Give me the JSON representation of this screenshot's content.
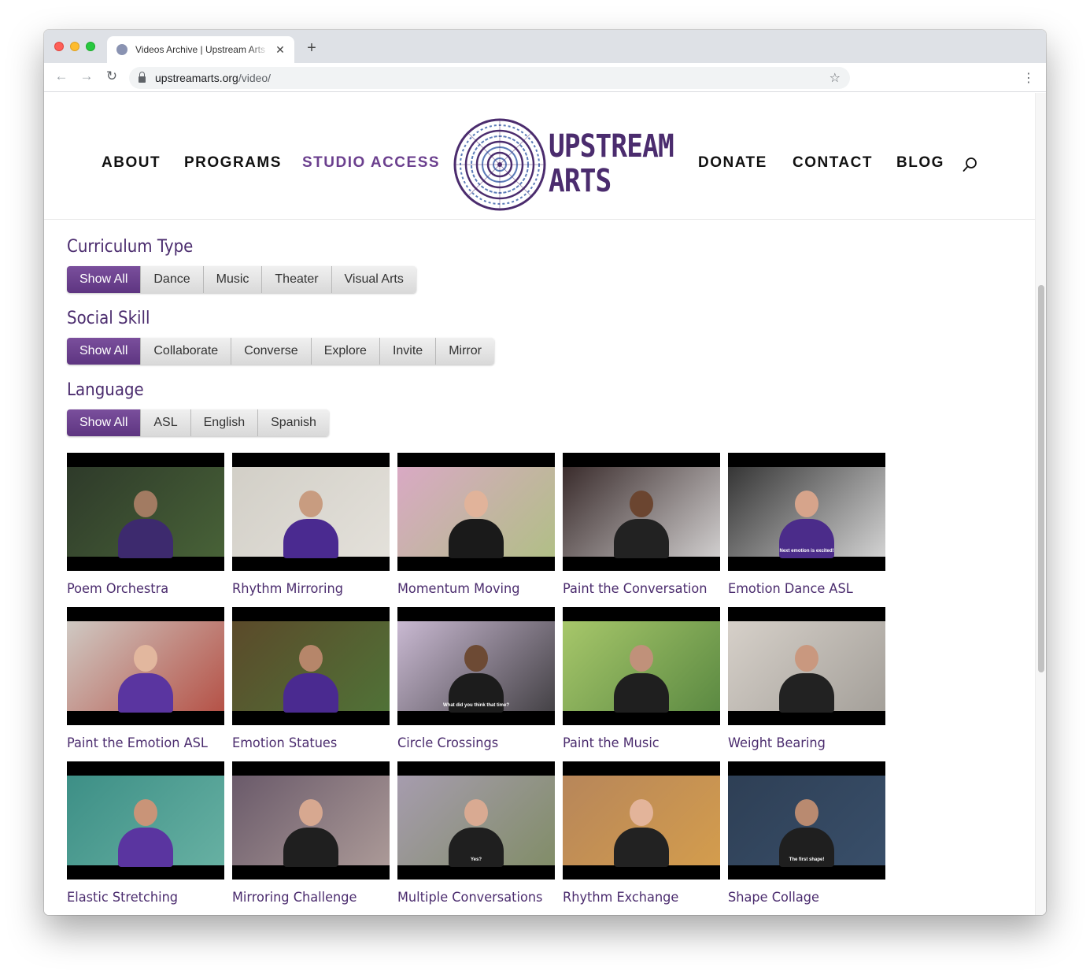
{
  "browser": {
    "tab_title": "Videos Archive | Upstream Arts",
    "url_host": "upstreamarts.org",
    "url_path": "/video/",
    "new_tab_symbol": "+",
    "close_symbol": "✕"
  },
  "nav": {
    "left": [
      "ABOUT",
      "PROGRAMS",
      "STUDIO ACCESS"
    ],
    "right": [
      "DONATE",
      "CONTACT",
      "BLOG"
    ],
    "active": "STUDIO ACCESS"
  },
  "logo": {
    "line1": "UPSTREAM",
    "line2": "ARTS"
  },
  "filters": [
    {
      "title": "Curriculum Type",
      "options": [
        "Show All",
        "Dance",
        "Music",
        "Theater",
        "Visual Arts"
      ],
      "selected": "Show All"
    },
    {
      "title": "Social Skill",
      "options": [
        "Show All",
        "Collaborate",
        "Converse",
        "Explore",
        "Invite",
        "Mirror"
      ],
      "selected": "Show All"
    },
    {
      "title": "Language",
      "options": [
        "Show All",
        "ASL",
        "English",
        "Spanish"
      ],
      "selected": "Show All"
    }
  ],
  "videos": [
    {
      "title": "Poem Orchestra",
      "bg": "#2e3a2a",
      "accent": "#4d6a3a",
      "shirt": "#3d2a6e",
      "skin": "#a27b62"
    },
    {
      "title": "Rhythm Mirroring",
      "bg": "#d2cfc7",
      "accent": "#e7e4de",
      "shirt": "#4a2a90",
      "skin": "#c89c80"
    },
    {
      "title": "Momentum Moving",
      "bg": "#d9a9c4",
      "accent": "#a9c37a",
      "shirt": "#1a1a1a",
      "skin": "#e1b39a"
    },
    {
      "title": "Paint the Conversation",
      "bg": "#3a2c2c",
      "accent": "#eeeeee",
      "shirt": "#222222",
      "skin": "#6b4530"
    },
    {
      "title": "Emotion Dance ASL",
      "bg": "#353535",
      "accent": "#f2f2f2",
      "shirt": "#4b2c8a",
      "skin": "#d6a48b"
    },
    {
      "title": "Paint the Emotion ASL",
      "bg": "#cfc9c3",
      "accent": "#b03a2e",
      "shirt": "#5a35a0",
      "skin": "#e2b79e"
    },
    {
      "title": "Emotion Statues",
      "bg": "#5b4a2a",
      "accent": "#4e7a3a",
      "shirt": "#4a2a90",
      "skin": "#b6866a"
    },
    {
      "title": "Circle Crossings",
      "bg": "#c9b9d2",
      "accent": "#2a2a2a",
      "shirt": "#1c1c1c",
      "skin": "#6d4a34"
    },
    {
      "title": "Paint the Music",
      "bg": "#a7c76a",
      "accent": "#4c7d3a",
      "shirt": "#1f1f1f",
      "skin": "#c0917a"
    },
    {
      "title": "Weight Bearing",
      "bg": "#d6d0c9",
      "accent": "#9a9690",
      "shirt": "#222222",
      "skin": "#c9987f"
    },
    {
      "title": "Elastic Stretching",
      "bg": "#3d8f86",
      "accent": "#6fb7a8",
      "shirt": "#5a35a0",
      "skin": "#c99478"
    },
    {
      "title": "Mirroring Challenge",
      "bg": "#6a5a6a",
      "accent": "#b8a6a0",
      "shirt": "#1f1f1f",
      "skin": "#d7a890"
    },
    {
      "title": "Multiple Conversations",
      "bg": "#a69cae",
      "accent": "#7a8a5a",
      "shirt": "#1f1f1f",
      "skin": "#d9aa92"
    },
    {
      "title": "Rhythm Exchange",
      "bg": "#b7865a",
      "accent": "#d9a14a",
      "shirt": "#222222",
      "skin": "#e3b49a"
    },
    {
      "title": "Shape Collage",
      "bg": "#2e3f55",
      "accent": "#3b526e",
      "shirt": "#1f1f1f",
      "skin": "#b98a70"
    }
  ],
  "captions": {
    "4": "Next emotion is excited!",
    "7": "What did you think that time?",
    "12": "Yes?",
    "14": "The first shape!"
  }
}
